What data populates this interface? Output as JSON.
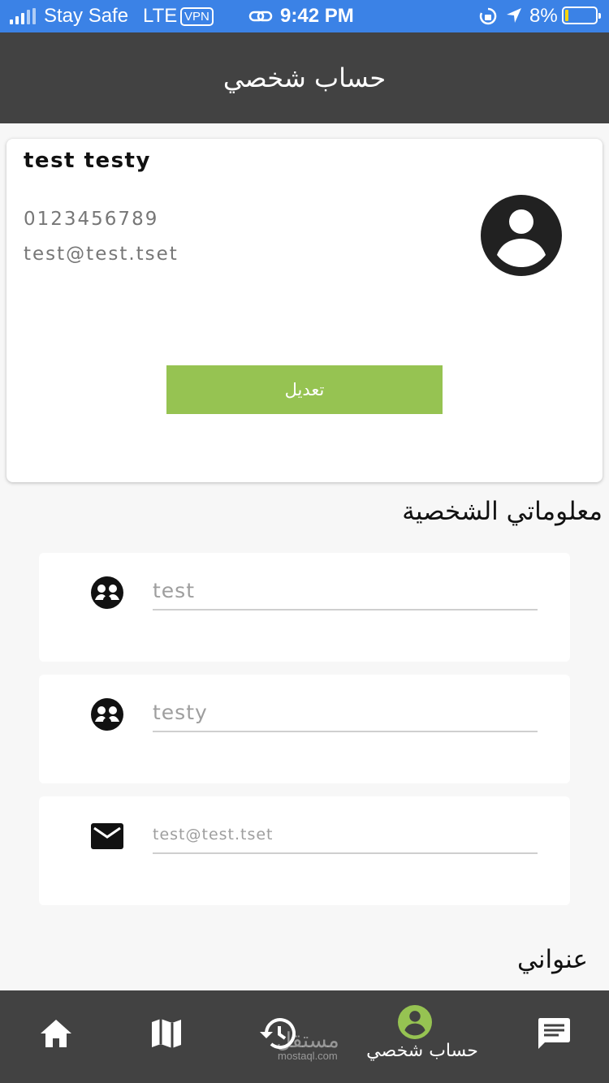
{
  "status_bar": {
    "carrier": "Stay Safe",
    "network": "LTE",
    "vpn": "VPN",
    "time": "9:42 PM",
    "battery": "8%",
    "battery_level": 0.08,
    "battery_color": "#f5d40e"
  },
  "header": {
    "title": "حساب شخصي"
  },
  "profile": {
    "name": "test testy",
    "phone": "0123456789",
    "email": "test@test.tset",
    "avatar_icon": "account-circle-icon",
    "edit_label": "تعديل",
    "edit_color": "#96c352"
  },
  "sections": {
    "personal_info": "معلوماتي الشخصية",
    "address": "عنواني"
  },
  "fields": [
    {
      "icon": "people-circle-icon",
      "value": "test"
    },
    {
      "icon": "people-circle-icon",
      "value": "testy"
    },
    {
      "icon": "mail-icon",
      "value": "test@test.tset"
    }
  ],
  "bottom_nav": {
    "items": [
      {
        "icon": "home-icon",
        "label": ""
      },
      {
        "icon": "map-icon",
        "label": ""
      },
      {
        "icon": "history-icon",
        "label": ""
      },
      {
        "icon": "account-circle-icon",
        "label": "حساب شخصي",
        "active": true
      },
      {
        "icon": "chat-icon",
        "label": ""
      }
    ],
    "active_color": "#96c352"
  },
  "watermark": {
    "arabic": "مستقل",
    "latin": "mostaql.com"
  },
  "colors": {
    "status_bar": "#3b82e6",
    "header": "#424242",
    "background": "#f7f7f7"
  }
}
